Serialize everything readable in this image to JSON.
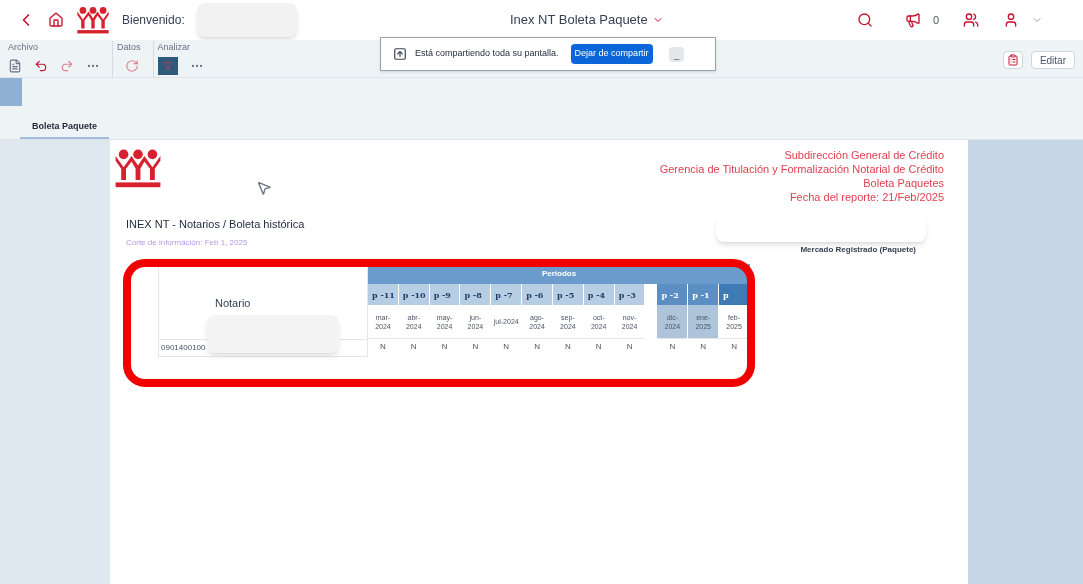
{
  "header": {
    "welcome": "Bienvenido:",
    "title": "Inex NT Boleta Paquete",
    "notifications": "0"
  },
  "toolbar": {
    "groups": [
      {
        "label": "Archivo"
      },
      {
        "label": "Datos"
      },
      {
        "label": "Analizar"
      }
    ],
    "edit_button": "Editar"
  },
  "share_bar": {
    "message": "Está compartiendo toda su pantalla.",
    "stop_button": "Dejar de compartir",
    "hide_button": "_"
  },
  "tabs": [
    {
      "label": "Boleta Paquete",
      "selected": true
    }
  ],
  "report": {
    "org_lines": [
      "Subdirección General de Crédito",
      "Gerencia de Titulación y Formalización Notarial de Crédito",
      "Boleta Paquetes",
      "Fecha del reporte: 21/Feb/2025"
    ],
    "title": "INEX NT - Notarios / Boleta histórica",
    "subtitle": "Corte de información: Feb 1, 2025",
    "market": "Mercado Registrado (Paquete)"
  },
  "table": {
    "notary_header": "Notario",
    "periods_header": "Periodos",
    "periods": [
      {
        "code": "p -11",
        "month": "mar-2024",
        "highlighted": false,
        "gap_before": false
      },
      {
        "code": "p -10",
        "month": "abr-2024",
        "highlighted": false,
        "gap_before": false
      },
      {
        "code": "p -9",
        "month": "may-2024",
        "highlighted": false,
        "gap_before": false
      },
      {
        "code": "p -8",
        "month": "jun-2024",
        "highlighted": false,
        "gap_before": false
      },
      {
        "code": "p -7",
        "month": "jul-2024",
        "highlighted": false,
        "gap_before": false
      },
      {
        "code": "p -6",
        "month": "ago-2024",
        "highlighted": false,
        "gap_before": false
      },
      {
        "code": "p -5",
        "month": "sep-2024",
        "highlighted": false,
        "gap_before": false
      },
      {
        "code": "p -4",
        "month": "oct-2024",
        "highlighted": false,
        "gap_before": false
      },
      {
        "code": "p -3",
        "month": "nov-2024",
        "highlighted": false,
        "gap_before": false
      },
      {
        "code": "p -2",
        "month": "dic-2024",
        "highlighted": true,
        "gap_before": true
      },
      {
        "code": "p -1",
        "month": "ene-2025",
        "highlighted": true,
        "gap_before": false
      },
      {
        "code": "p",
        "month": "feb-2025",
        "highlighted": false,
        "gap_before": false
      }
    ],
    "rows": [
      {
        "id": "0901400100",
        "values": [
          "N",
          "N",
          "N",
          "N",
          "N",
          "N",
          "N",
          "N",
          "N",
          "N",
          "N",
          "N"
        ]
      }
    ]
  }
}
